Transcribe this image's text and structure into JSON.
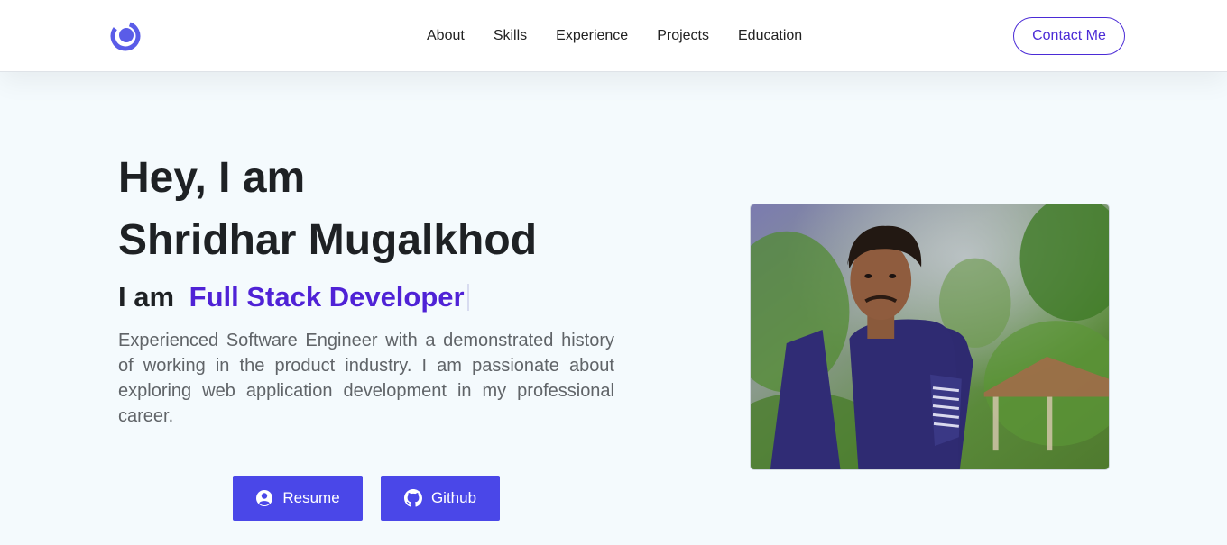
{
  "navbar": {
    "logo_icon": "ring-logo-icon",
    "links": [
      "About",
      "Skills",
      "Experience",
      "Projects",
      "Education"
    ],
    "contact_label": "Contact Me"
  },
  "hero": {
    "greeting": "Hey, I am",
    "name": "Shridhar Mugalkhod",
    "tagline_prefix": "I am",
    "tagline_role": "Full Stack Developer",
    "intro": "Experienced Software Engineer with a demonstrated history of working in the product industry. I am passionate about exploring web application development in my professional career.",
    "buttons": {
      "resume": {
        "label": "Resume",
        "icon": "user-circle-icon"
      },
      "github": {
        "label": "Github",
        "icon": "github-icon"
      }
    }
  },
  "colors": {
    "accent": "#4f22d6",
    "button": "#4a47e8",
    "logo": "#5a5ce8",
    "background": "#f4fafd"
  }
}
